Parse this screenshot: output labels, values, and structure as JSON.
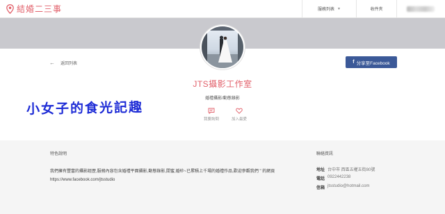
{
  "header": {
    "brand": "結婚二三事",
    "nav": {
      "services": "服務列表",
      "favorites": "收件夾"
    }
  },
  "back": {
    "label": "返回列表"
  },
  "share": {
    "label": "分享至Facebook"
  },
  "studio": {
    "name": "JTS攝影工作室",
    "category": "婚禮攝影/動態錄影"
  },
  "actions": {
    "message": "我要詢問",
    "favorite": "加入最愛"
  },
  "watermark": "小女子的食光記趣",
  "features": {
    "title": "特色說明",
    "lines": [
      "我們擁有豐富的攝影經歷,服務內容包含婚禮平面攝影,動態錄影,閨蜜,婚紗~已累積上千場的婚禮作品,歡迎參觀我們 \" 的網頁",
      "https://www.facebook.com/jtsstudio"
    ]
  },
  "contact": {
    "title": "聯絡資訊",
    "rows": [
      {
        "key": "地址",
        "value": "台中市 西區五權五街80號"
      },
      {
        "key": "電話",
        "value": "0922442238"
      },
      {
        "key": "信箱",
        "value": "jtsstudio@hotmail.com"
      }
    ]
  },
  "colors": {
    "brand": "#e2616b",
    "facebook": "#3b5998",
    "watermark": "#1e2cd6"
  }
}
